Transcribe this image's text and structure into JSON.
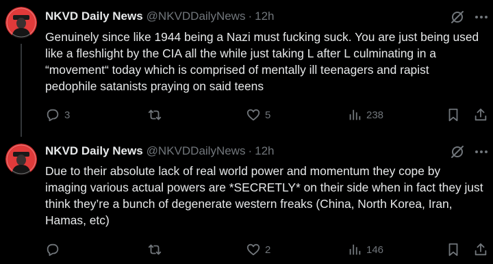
{
  "tweets": [
    {
      "display_name": "NKVD Daily News",
      "handle": "@NKVDDailyNews",
      "separator": "·",
      "time": "12h",
      "text": "Genuinely since like 1944 being a Nazi must fucking suck. You are just being used like a fleshlight by the CIA all the while just taking L after L culminating in a “movement“ today which is comprised of mentally ill teenagers and rapist pedophile satanists praying on said teens",
      "replies": "3",
      "reposts": "",
      "likes": "5",
      "views": "238"
    },
    {
      "display_name": "NKVD Daily News",
      "handle": "@NKVDDailyNews",
      "separator": "·",
      "time": "12h",
      "text": "Due to their absolute lack of real world power and momentum they cope by imaging various actual powers are *SECRETLY* on their side when in fact they just think they’re a bunch of degenerate western freaks (China, North Korea, Iran, Hamas, etc)",
      "replies": "",
      "reposts": "",
      "likes": "2",
      "views": "146"
    }
  ],
  "icons": {
    "reply": "reply-icon",
    "repost": "repost-icon",
    "like": "heart-icon",
    "views": "views-icon",
    "bookmark": "bookmark-icon",
    "share": "share-icon",
    "grok": "grok-icon",
    "more": "more-icon"
  },
  "colors": {
    "background": "#000000",
    "text": "#e7e9ea",
    "muted": "#71767b",
    "avatar_red": "#d22b2b"
  }
}
